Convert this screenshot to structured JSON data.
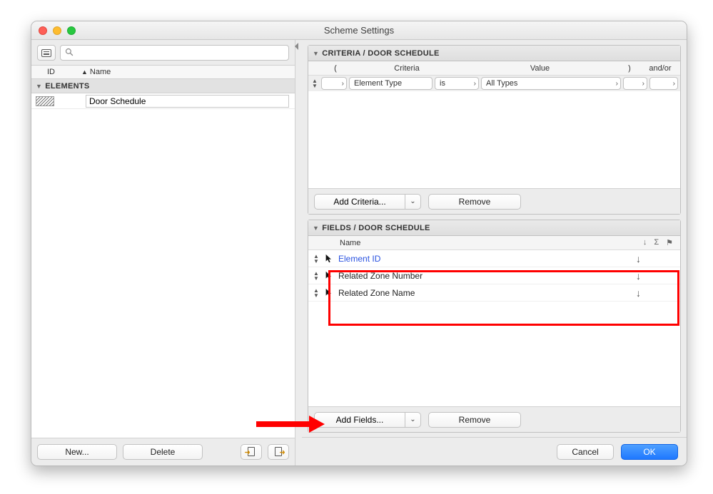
{
  "window_title": "Scheme Settings",
  "left": {
    "columns": {
      "id": "ID",
      "name": "Name"
    },
    "group": "ELEMENTS",
    "items": [
      {
        "id": "",
        "name": "Door Schedule"
      }
    ],
    "footer": {
      "new": "New...",
      "delete": "Delete"
    }
  },
  "criteria": {
    "header": "CRITERIA /  DOOR SCHEDULE",
    "columns": {
      "paren_open": "(",
      "criteria": "Criteria",
      "value": "Value",
      "paren_close": ")",
      "andor": "and/or"
    },
    "row": {
      "criteria": "Element Type",
      "operator": "is",
      "value": "All Types"
    },
    "footer": {
      "add": "Add Criteria...",
      "remove": "Remove"
    }
  },
  "fields": {
    "header": "FIELDS /  DOOR SCHEDULE",
    "col_name": "Name",
    "rows": [
      {
        "name": "Element ID",
        "hl": true
      },
      {
        "name": "Related Zone Number",
        "hl": false
      },
      {
        "name": "Related Zone Name",
        "hl": false
      }
    ],
    "footer": {
      "add": "Add Fields...",
      "remove": "Remove"
    }
  },
  "dialog": {
    "cancel": "Cancel",
    "ok": "OK"
  }
}
